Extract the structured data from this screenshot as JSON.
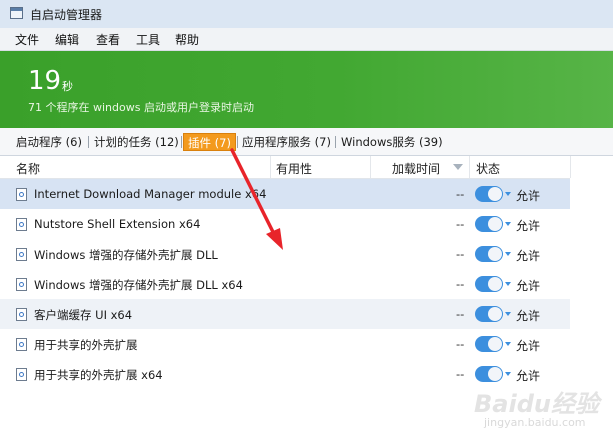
{
  "window": {
    "title": "自启动管理器",
    "icon": "app-window-icon"
  },
  "menu": [
    {
      "label": "文件"
    },
    {
      "label": "编辑"
    },
    {
      "label": "查看"
    },
    {
      "label": "工具"
    },
    {
      "label": "帮助"
    }
  ],
  "banner": {
    "seconds": "19",
    "seconds_unit": "秒",
    "summary": "71 个程序在 windows 启动或用户登录时启动",
    "color": "#42a832"
  },
  "tabs": [
    {
      "label": "启动程序 (6)",
      "active": false
    },
    {
      "label": "计划的任务 (12)",
      "active": false
    },
    {
      "label": "插件 (7)",
      "active": true
    },
    {
      "label": "应用程序服务 (7)",
      "active": false
    },
    {
      "label": "Windows服务 (39)",
      "active": false
    }
  ],
  "columns": {
    "name": "名称",
    "usefulness": "有用性",
    "load_time": "加载时间",
    "status": "状态"
  },
  "rows": [
    {
      "name": "Internet Download Manager module x64",
      "load_time": "--",
      "status": "允许",
      "enabled": true,
      "selected": true
    },
    {
      "name": "Nutstore Shell Extension x64",
      "load_time": "--",
      "status": "允许",
      "enabled": true
    },
    {
      "name": "Windows 增强的存储外壳扩展 DLL",
      "load_time": "--",
      "status": "允许",
      "enabled": true
    },
    {
      "name": "Windows 增强的存储外壳扩展 DLL x64",
      "load_time": "--",
      "status": "允许",
      "enabled": true
    },
    {
      "name": "客户端缓存 UI x64",
      "load_time": "--",
      "status": "允许",
      "enabled": true
    },
    {
      "name": "用于共享的外壳扩展",
      "load_time": "--",
      "status": "允许",
      "enabled": true
    },
    {
      "name": "用于共享的外壳扩展 x64",
      "load_time": "--",
      "status": "允许",
      "enabled": true
    }
  ],
  "colors": {
    "accent_tab": "#f39a1e",
    "toggle_on": "#3c8fde",
    "annotation_arrow": "#e8242a"
  },
  "watermark": {
    "brand": "Baidu经验",
    "url": "jingyan.baidu.com"
  }
}
